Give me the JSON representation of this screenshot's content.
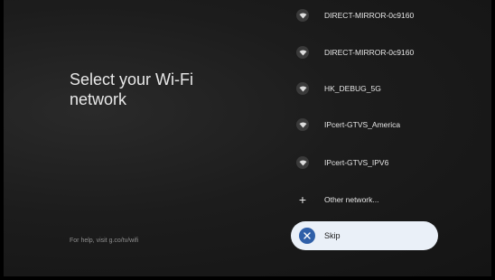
{
  "title": "Select your Wi-Fi network",
  "help_text": "For help, visit g.co/tv/wifi",
  "networks": [
    {
      "name": "DIRECT-MIRROR-0c9160",
      "icon": "wifi-icon"
    },
    {
      "name": "DIRECT-MIRROR-0c9160",
      "icon": "wifi-icon"
    },
    {
      "name": "HK_DEBUG_5G",
      "icon": "wifi-icon"
    },
    {
      "name": "IPcert-GTVS_America",
      "icon": "wifi-icon"
    },
    {
      "name": "IPcert-GTVS_IPV6",
      "icon": "wifi-icon"
    }
  ],
  "other_network": {
    "label": "Other network...",
    "icon": "plus-icon"
  },
  "skip": {
    "label": "Skip",
    "icon": "close-icon",
    "accent": "#2f5fa8",
    "background": "#eaf0f8"
  }
}
